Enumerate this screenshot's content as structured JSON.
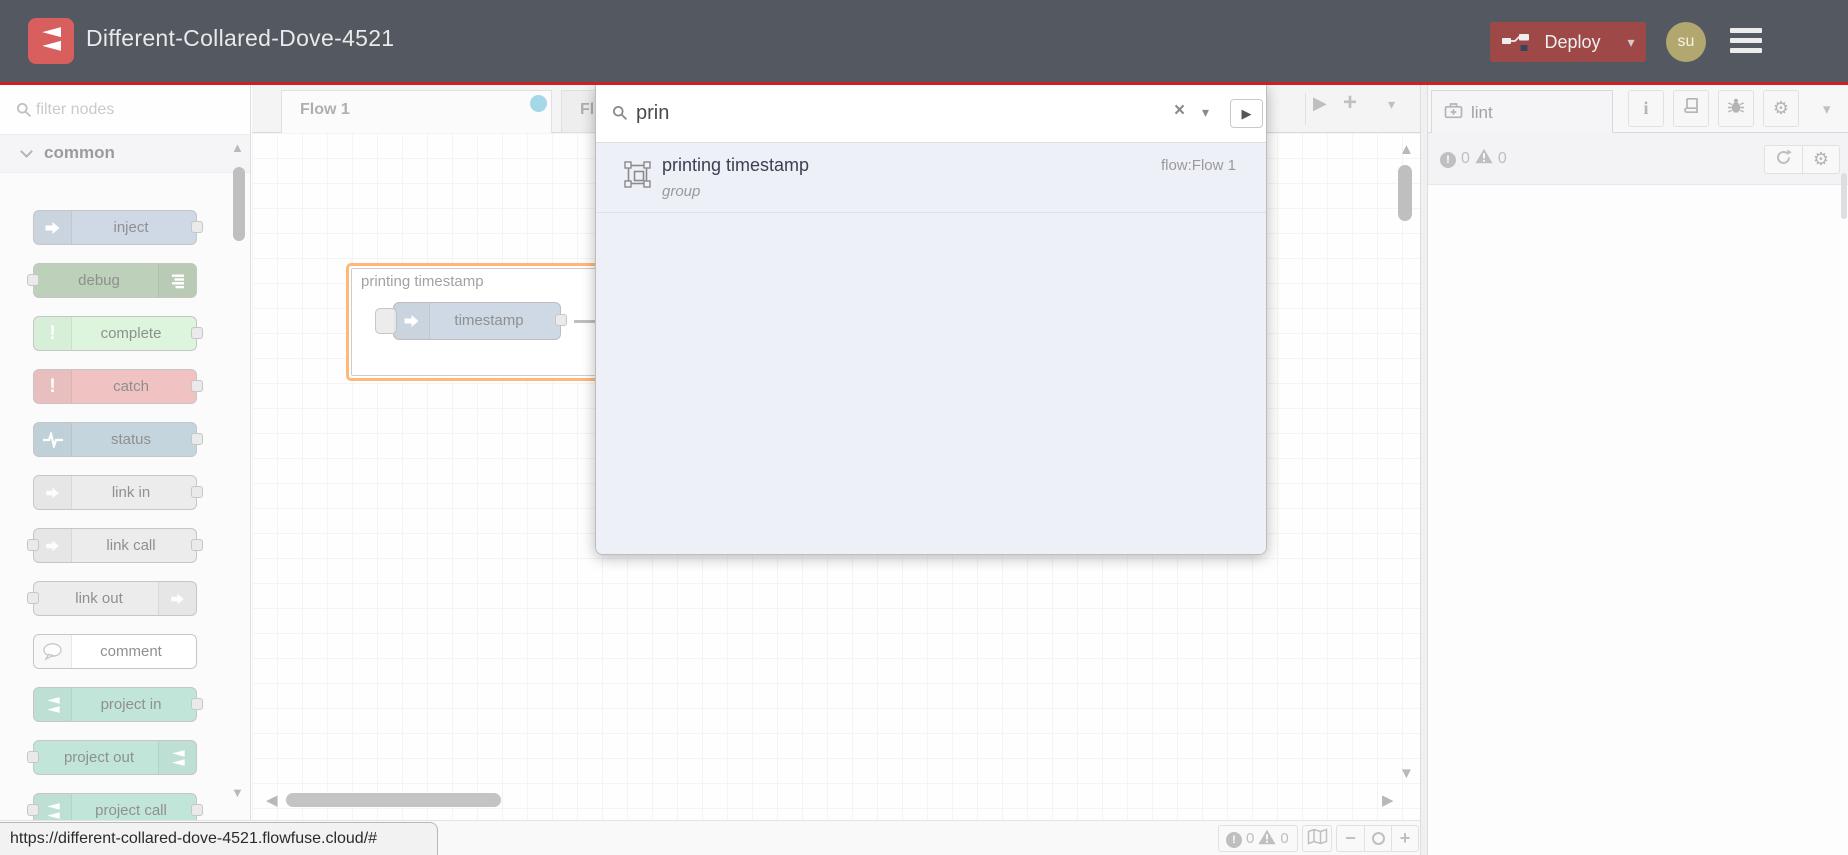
{
  "header": {
    "title": "Different-Collared-Dove-4521",
    "deploy": {
      "label": "Deploy",
      "icon": "deploy-nodes-icon"
    },
    "avatar_initials": "su",
    "colors": {
      "bar": "#545861",
      "accent_line": "#d01f1f",
      "deploy_bg": "#9e4848",
      "avatar_bg": "#b2a76f",
      "logo_bg": "#d95f5f"
    }
  },
  "palette": {
    "filter_placeholder": "filter nodes",
    "category_label": "common",
    "nodes": [
      {
        "label": "inject",
        "color": "#a6bbcf",
        "icon": "inject-arrow-icon",
        "icon_side": "left",
        "ports": [
          "right"
        ]
      },
      {
        "label": "debug",
        "color": "#87a980",
        "icon": "debug-sink-icon",
        "icon_side": "right",
        "ports": [
          "left"
        ]
      },
      {
        "label": "complete",
        "color": "#c0edc0",
        "icon": "exclamation-icon",
        "icon_side": "left",
        "ports": [
          "right"
        ]
      },
      {
        "label": "catch",
        "color": "#e49191",
        "icon": "exclamation-icon",
        "icon_side": "left",
        "ports": [
          "right"
        ]
      },
      {
        "label": "status",
        "color": "#94b3c4",
        "icon": "pulse-icon",
        "icon_side": "left",
        "ports": [
          "right"
        ]
      },
      {
        "label": "link in",
        "color": "#dddddd",
        "icon": "link-arrow-icon",
        "icon_side": "left",
        "ports": [
          "right"
        ]
      },
      {
        "label": "link call",
        "color": "#dddddd",
        "icon": "link-arrow-icon",
        "icon_side": "left",
        "ports": [
          "left",
          "right"
        ]
      },
      {
        "label": "link out",
        "color": "#dddddd",
        "icon": "link-arrow-icon",
        "icon_side": "right",
        "ports": [
          "left"
        ]
      },
      {
        "label": "comment",
        "color": "#ffffff",
        "icon": "comment-bubble-icon",
        "icon_side": "left",
        "ports": []
      },
      {
        "label": "project in",
        "color": "#8fd0bb",
        "icon": "flowfuse-logo-icon",
        "icon_side": "left",
        "ports": [
          "right"
        ]
      },
      {
        "label": "project out",
        "color": "#8fd0bb",
        "icon": "flowfuse-logo-icon",
        "icon_side": "right",
        "ports": [
          "left"
        ]
      },
      {
        "label": "project call",
        "color": "#8fd0bb",
        "icon": "flowfuse-logo-icon",
        "icon_side": "left",
        "ports": [
          "left",
          "right"
        ]
      }
    ]
  },
  "workspace": {
    "tabs": [
      {
        "label": "Flow 1",
        "active": true,
        "unsaved_dot": true
      },
      {
        "label": "Fl",
        "active": false
      }
    ],
    "dot_color": "#5ab6d6",
    "group": {
      "label": "printing timestamp",
      "border_color": "#ff7f0e",
      "node": {
        "label": "timestamp",
        "color": "#a6bbcf",
        "icon": "inject-arrow-icon"
      }
    },
    "footer": {
      "error_count": "0",
      "warning_count": "0"
    }
  },
  "search": {
    "value": "prin",
    "result": {
      "title": "printing timestamp",
      "subtitle": "group",
      "location": "flow:Flow 1",
      "icon": "group-icon"
    }
  },
  "sidebar": {
    "tab_label": "lint",
    "tab_icon": "medkit-icon",
    "toolbar_icons": [
      "info-icon",
      "book-icon",
      "bug-icon",
      "gear-icon"
    ],
    "error_count": "0",
    "warning_count": "0"
  },
  "browser": {
    "link_preview_url": "https://different-collared-dove-4521.flowfuse.cloud/#"
  }
}
